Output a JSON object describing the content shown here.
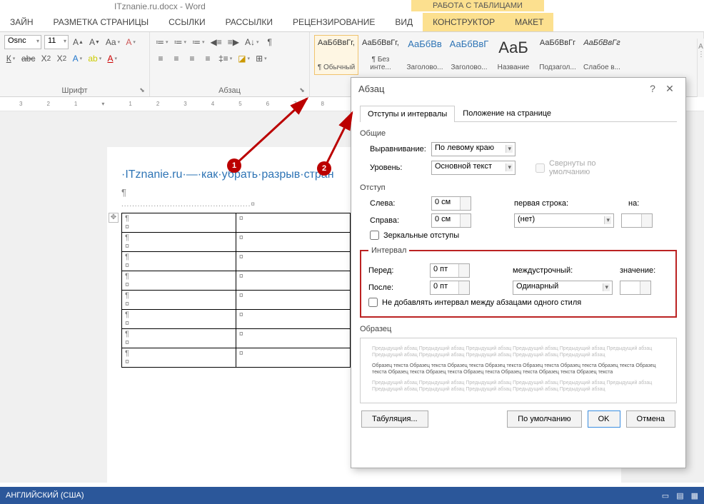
{
  "title": "ITznanie.ru.docx - Word",
  "table_tools": "РАБОТА С ТАБЛИЦАМИ",
  "ribbon_tabs": [
    "ЗАЙН",
    "РАЗМЕТКА СТРАНИЦЫ",
    "ССЫЛКИ",
    "РАССЫЛКИ",
    "РЕЦЕНЗИРОВАНИЕ",
    "ВИД",
    "КОНСТРУКТОР",
    "МАКЕТ"
  ],
  "font": {
    "name": "Osnc",
    "size": "11"
  },
  "group_labels": {
    "font": "Шрифт",
    "para": "Абзац"
  },
  "styles": [
    {
      "preview": "АаБбВвГг,",
      "name": "¶ Обычный"
    },
    {
      "preview": "АаБбВвГг,",
      "name": "¶ Без инте..."
    },
    {
      "preview": "АаБбВв",
      "name": "Заголово..."
    },
    {
      "preview": "АаБбВвГ",
      "name": "Заголово..."
    },
    {
      "preview": "АаБ",
      "name": "Название"
    },
    {
      "preview": "АаБбВвГг",
      "name": "Подзагол..."
    },
    {
      "preview": "АаБбВвГг",
      "name": "Слабое в..."
    }
  ],
  "ruler_nums": [
    "3",
    "2",
    "1",
    "",
    "1",
    "2",
    "3",
    "4",
    "5",
    "6",
    "7",
    "8"
  ],
  "doc": {
    "title_text": "·ITznanie.ru·—·как·убрать·разрыв·стран",
    "dots": "................................................¤"
  },
  "table_cell": "¶",
  "table_cell2": "¤",
  "dialog": {
    "title": "Абзац",
    "tab1": "Отступы и интервалы",
    "tab2": "Положение на странице",
    "general": "Общие",
    "align_label": "Выравнивание:",
    "align_value": "По левому краю",
    "level_label": "Уровень:",
    "level_value": "Основной текст",
    "collapse": "Свернуты по умолчанию",
    "indent": "Отступ",
    "left_label": "Слева:",
    "left_value": "0 см",
    "right_label": "Справа:",
    "right_value": "0 см",
    "first_line": "первая строка:",
    "first_value": "(нет)",
    "on_label": "на:",
    "mirror": "Зеркальные отступы",
    "interval": "Интервал",
    "before_label": "Перед:",
    "before_value": "0 пт",
    "after_label": "После:",
    "after_value": "0 пт",
    "linespacing": "междустрочный:",
    "ls_value": "Одинарный",
    "value_label": "значение:",
    "noadd": "Не добавлять интервал между абзацами одного стиля",
    "sample": "Образец",
    "prev_text": "Предыдущий абзац Предыдущий абзац Предыдущий абзац Предыдущий абзац Предыдущий абзац Предыдущий абзац Предыдущий абзац Предыдущий абзац Предыдущий абзац Предыдущий абзац Предыдущий абзац",
    "sample_text": "Образец текста Образец текста Образец текста Образец текста Образец текста Образец текста Образец текста Образец текста Образец текста Образец текста Образец текста Образец текста Образец текста Образец текста",
    "tabs_btn": "Табуляция...",
    "default_btn": "По умолчанию",
    "ok": "OK",
    "cancel": "Отмена"
  },
  "badges": {
    "b1": "1",
    "b2": "2"
  },
  "status": {
    "lang": "АНГЛИЙСКИЙ (США)"
  }
}
